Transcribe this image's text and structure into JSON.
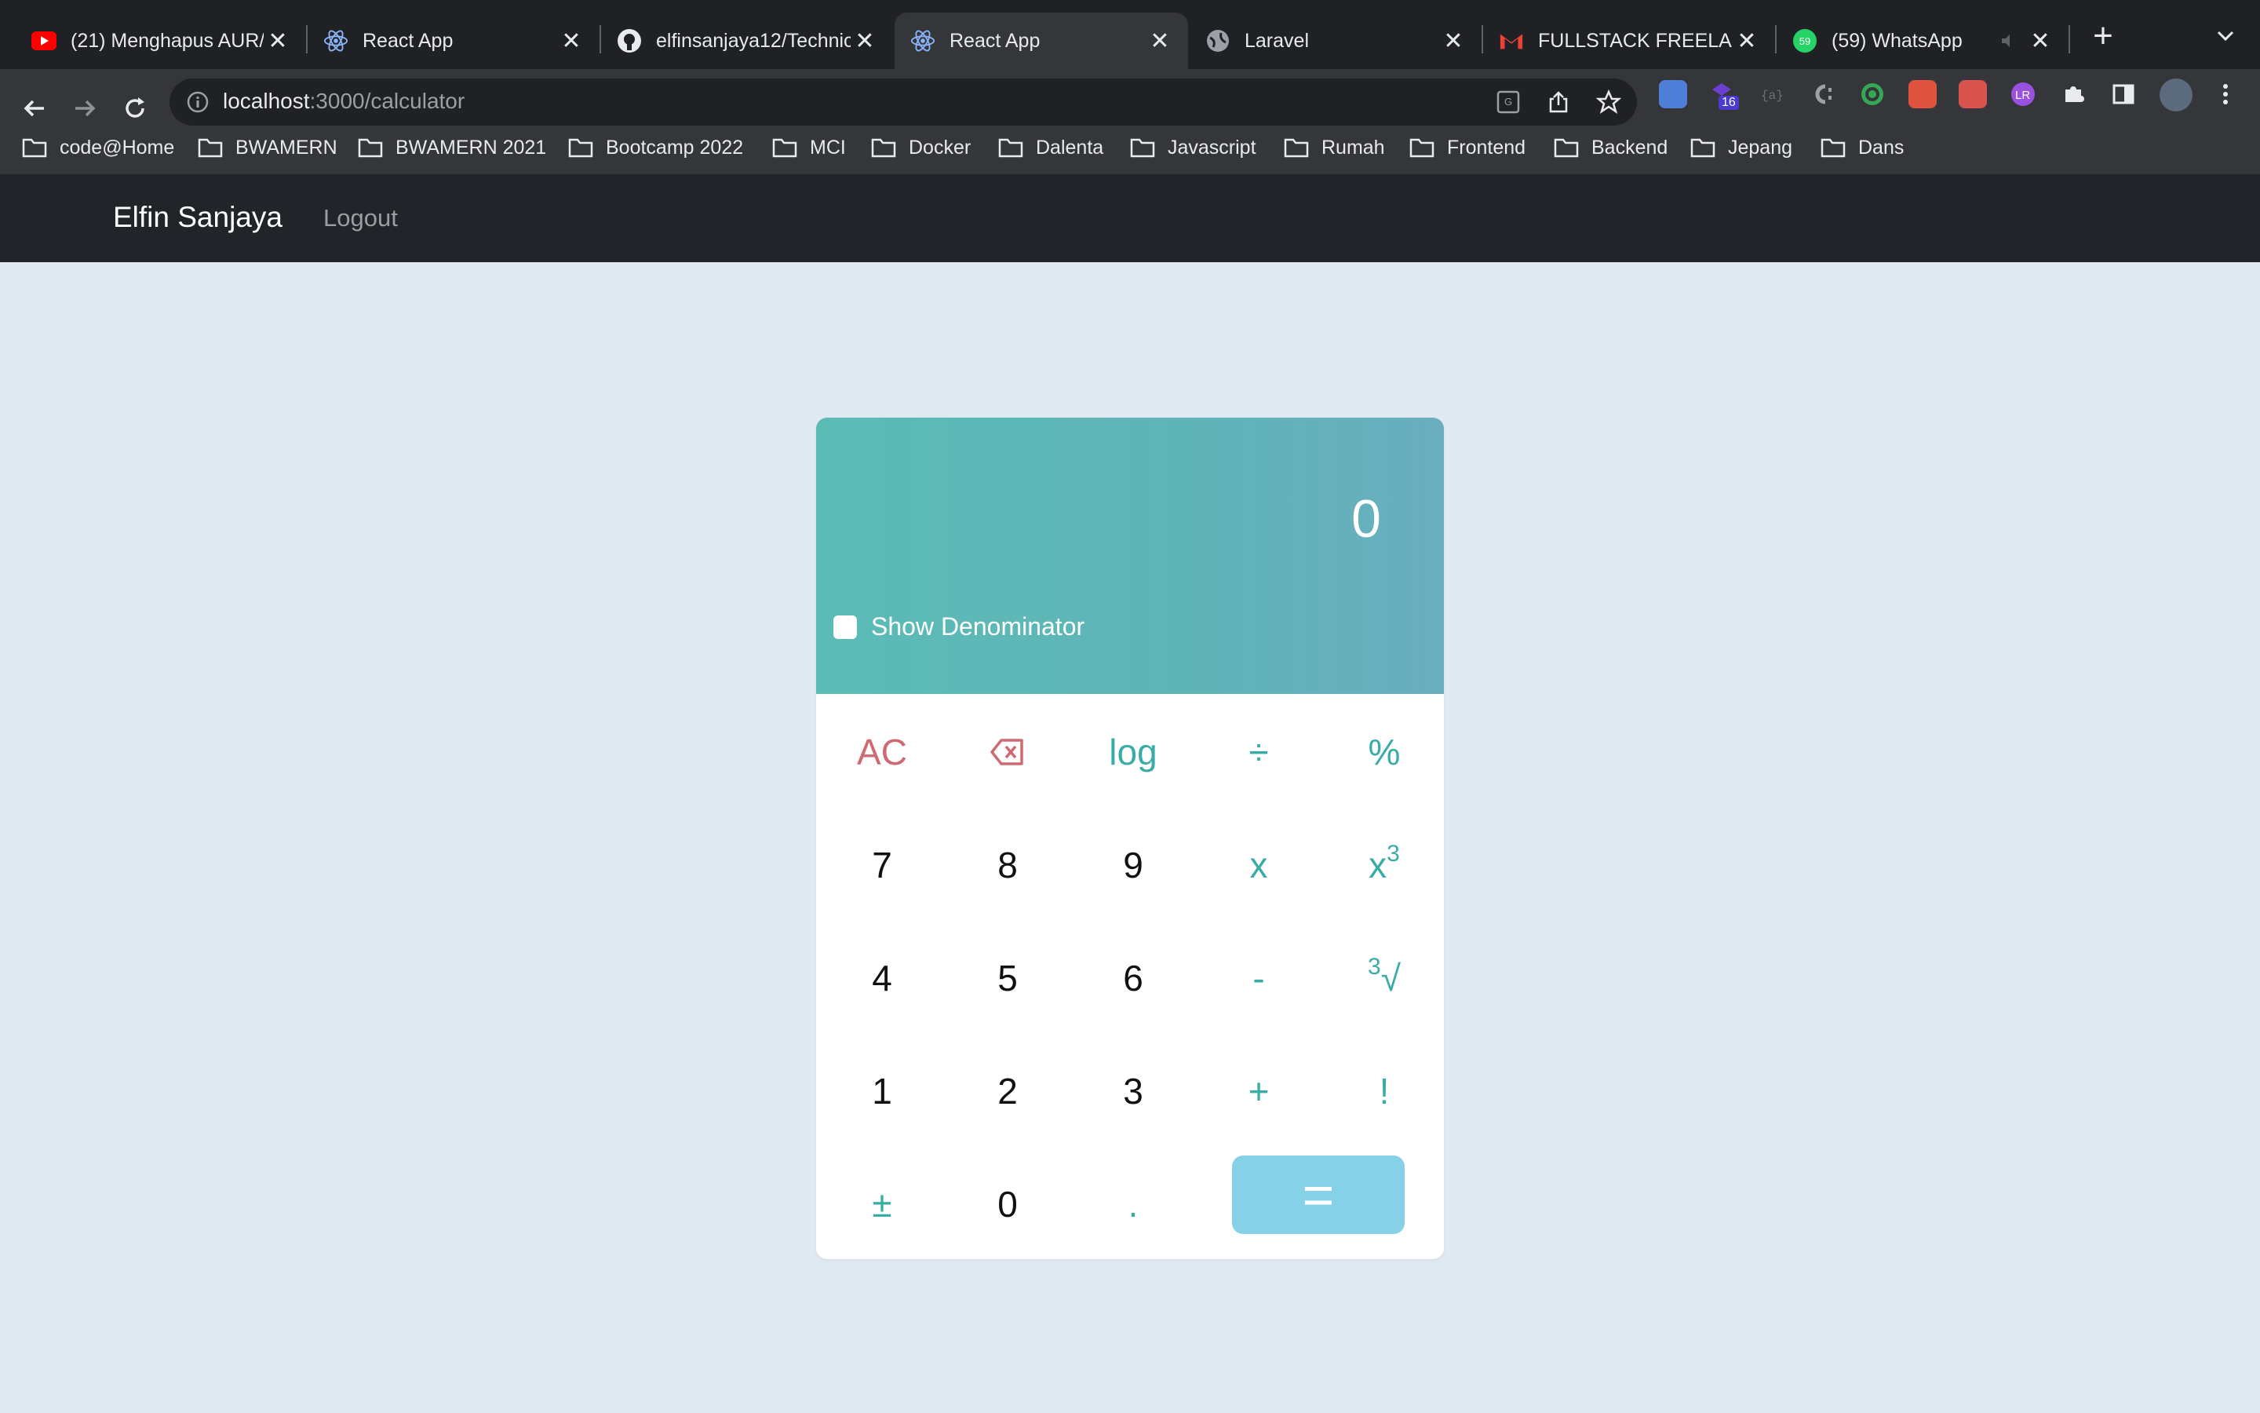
{
  "browser": {
    "tabs": [
      {
        "title": "(21) Menghapus AUR/",
        "icon": "youtube-icon"
      },
      {
        "title": "React App",
        "icon": "react-icon"
      },
      {
        "title": "elfinsanjaya12/Technic",
        "icon": "github-icon"
      },
      {
        "title": "React App",
        "icon": "react-icon",
        "active": true
      },
      {
        "title": "Laravel",
        "icon": "globe-icon"
      },
      {
        "title": "FULLSTACK FREELAN",
        "icon": "gmail-icon"
      },
      {
        "title": "(59) WhatsApp",
        "icon": "whatsapp-icon"
      }
    ],
    "close_glyph": "✕",
    "new_tab_glyph": "+",
    "url_host": "localhost",
    "url_rest": ":3000/calculator",
    "extension_badge": "16",
    "bookmarks": [
      "code@Home",
      "BWAMERN",
      "BWAMERN 2021",
      "Bootcamp 2022",
      "MCI",
      "Docker",
      "Dalenta",
      "Javascript",
      "Rumah",
      "Frontend",
      "Backend",
      "Jepang",
      "Dans"
    ]
  },
  "app": {
    "brand": "Elfin Sanjaya",
    "logout": "Logout"
  },
  "calculator": {
    "display": "0",
    "denominator_label": "Show Denominator",
    "denominator_checked": false,
    "keys": {
      "ac": "AC",
      "log": "log",
      "divide": "÷",
      "percent": "%",
      "seven": "7",
      "eight": "8",
      "nine": "9",
      "multiply": "x",
      "cube_base": "x",
      "cube_exp": "3",
      "four": "4",
      "five": "5",
      "six": "6",
      "minus": "-",
      "root_index": "3",
      "root_sign": "√",
      "one": "1",
      "two": "2",
      "three": "3",
      "plus": "+",
      "factorial": "!",
      "plus_minus": "±",
      "zero": "0",
      "dot": ".",
      "equals": "="
    },
    "colors": {
      "teal": "#3aaca8",
      "red": "#d06a72",
      "equals_bg": "#87d1e8"
    }
  }
}
